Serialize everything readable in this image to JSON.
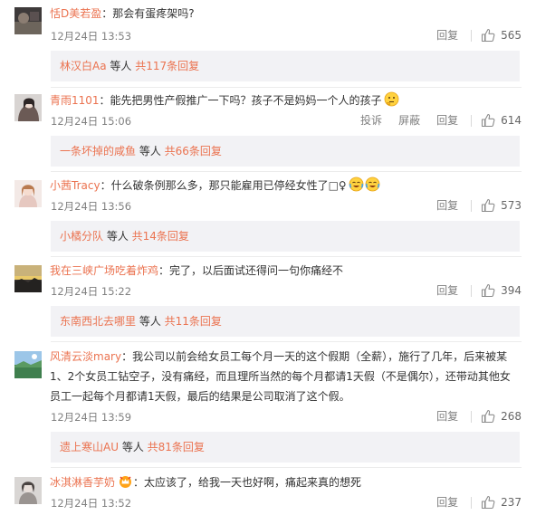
{
  "comments": [
    {
      "user": "恬D美若盈",
      "text": "：那会有蛋疼架吗?",
      "time": "12月24日 13:53",
      "reply": "回复",
      "likes": "565",
      "sub": {
        "name": "林汉白Aa",
        "mid": " 等人 ",
        "count": "共117条回复"
      }
    },
    {
      "user": "青雨1101",
      "text": "：能先把男性产假推广一下吗？孩子不是妈妈一个人的孩子",
      "time": "12月24日 15:06",
      "report": "投诉",
      "block": "屏蔽",
      "reply": "回复",
      "likes": "614",
      "sub": {
        "name": "一条坏掉的咸鱼",
        "mid": " 等人 ",
        "count": "共66条回复"
      }
    },
    {
      "user": "小茜Tracy",
      "text": "：什么破条例那么多，那只能雇用已停经女性了□♀",
      "time": "12月24日 13:56",
      "reply": "回复",
      "likes": "573",
      "sub": {
        "name": "小橘分队",
        "mid": " 等人 ",
        "count": "共14条回复"
      }
    },
    {
      "user": "我在三峡广场吃着炸鸡",
      "text": "：完了，以后面试还得问一句你痛经不",
      "time": "12月24日 15:22",
      "reply": "回复",
      "likes": "394",
      "sub": {
        "name": "东南西北去哪里",
        "mid": " 等人 ",
        "count": "共11条回复"
      }
    },
    {
      "user": "风清云淡mary",
      "text_lines": [
        "：我公司以前会给女员工每个月一天的这个假期（全薪），施行了几年，后来被某",
        "1、2个女员工钻空子，没有痛经，而且理所当然的每个月都请1天假（不是偶尔），还带动其他女",
        "员工一起每个月都请1天假，最后的结果是公司取消了这个假。"
      ],
      "time": "12月24日 13:59",
      "reply": "回复",
      "likes": "268",
      "sub": {
        "name": "遗上寒山AU",
        "mid": " 等人 ",
        "count": "共81条回复"
      }
    },
    {
      "user": "冰淇淋香芋奶",
      "text": "：太应该了，给我一天也好啊，痛起来真的想死",
      "time": "12月24日 13:52",
      "reply": "回复",
      "likes": "237"
    }
  ],
  "colors": {
    "username": "#eb7350",
    "meta": "#808080",
    "subBg": "#f2f2f5"
  }
}
